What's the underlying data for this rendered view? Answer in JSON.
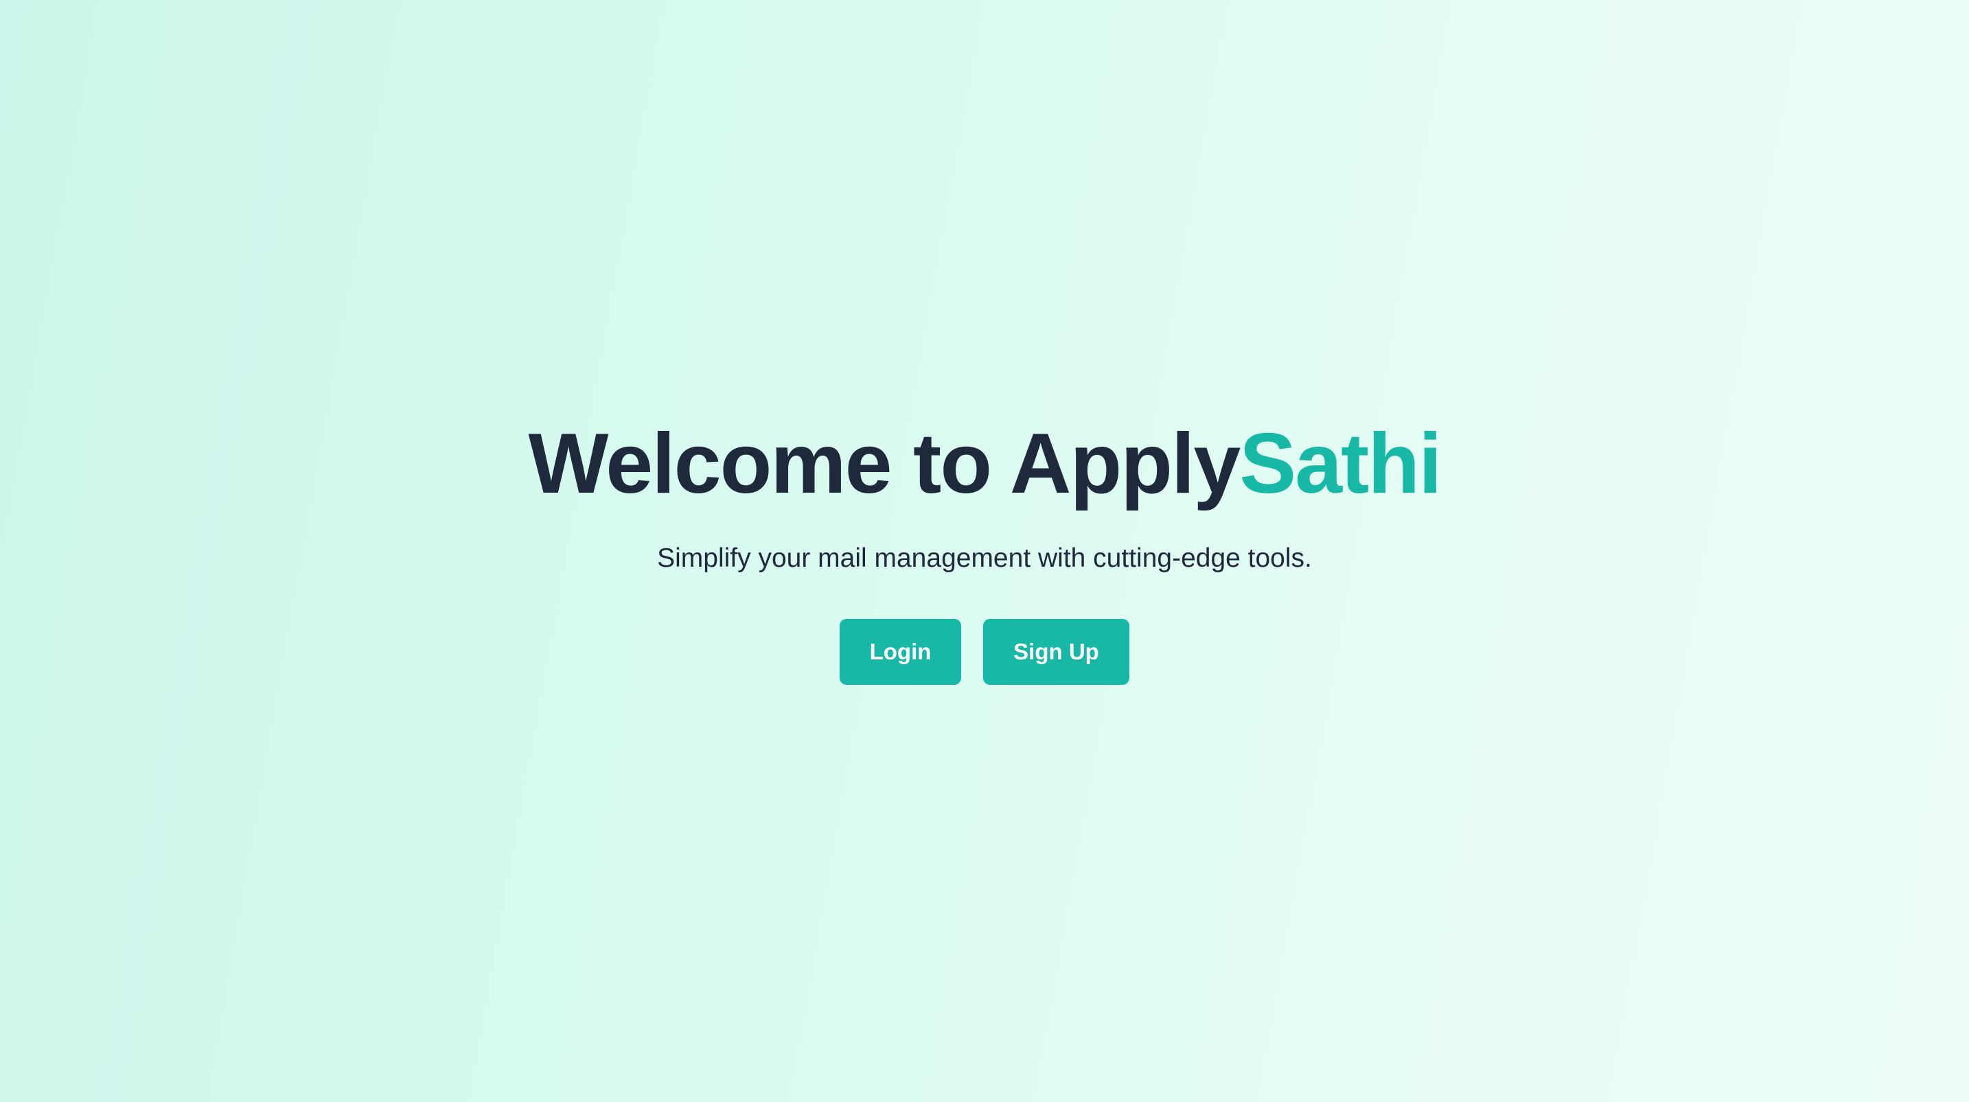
{
  "hero": {
    "title_prefix": "Welcome to Apply",
    "title_accent": "Sathi",
    "subtitle": "Simplify your mail management with cutting-edge tools."
  },
  "actions": {
    "login_label": "Login",
    "signup_label": "Sign Up"
  },
  "colors": {
    "accent": "#17b8a6",
    "text_dark": "#1e293b",
    "background_start": "#cdf7ec",
    "background_end": "#effdf9"
  }
}
